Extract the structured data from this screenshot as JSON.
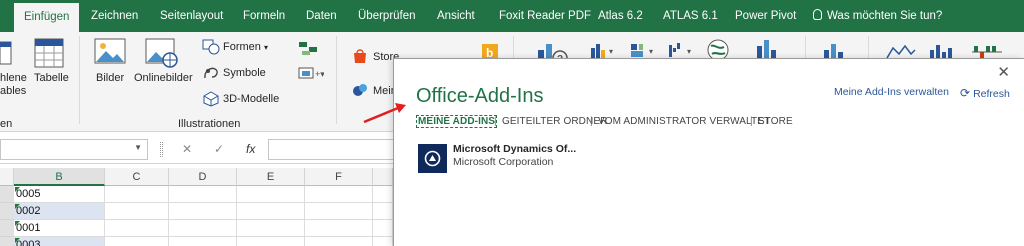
{
  "tabs": [
    {
      "label": "Einfügen",
      "active": true
    },
    {
      "label": "Zeichnen"
    },
    {
      "label": "Seitenlayout"
    },
    {
      "label": "Formeln"
    },
    {
      "label": "Daten"
    },
    {
      "label": "Überprüfen"
    },
    {
      "label": "Ansicht"
    },
    {
      "label": "Foxit Reader PDF"
    },
    {
      "label": "Atlas 6.2"
    },
    {
      "label": "ATLAS 6.1"
    },
    {
      "label": "Power Pivot"
    }
  ],
  "tell_me": "Was möchten Sie tun?",
  "ribbon": {
    "table_cut_line1": "hlene",
    "table_cut_line2": "ables",
    "tabelle": "Tabelle",
    "left_group_cut": "en",
    "bilder": "Bilder",
    "onlinebilder": "Onlinebilder",
    "formen": "Formen",
    "symbole": "Symbole",
    "modelle": "3D-Modelle",
    "illustrationen": "Illustrationen",
    "store": "Store",
    "meine_cut": "Mein"
  },
  "formula_bar": {
    "fx": "fx",
    "cancel": "✕",
    "enter": "✓"
  },
  "grid": {
    "columns": [
      "B",
      "C",
      "D",
      "E",
      "F"
    ],
    "rows": [
      {
        "b": "0005"
      },
      {
        "b": "0002"
      },
      {
        "b": "0001"
      },
      {
        "b": "0003"
      }
    ]
  },
  "dialog": {
    "title": "Office-Add-Ins",
    "close": "✕",
    "manage": "Meine Add-Ins verwalten",
    "refresh": "Refresh",
    "tabs": [
      "MEINE ADD-INS",
      "GEITEILTER ORDNER",
      "VOM ADMINISTRATOR VERWALTET",
      "STORE"
    ],
    "addin": {
      "name": "Microsoft Dynamics Of...",
      "publisher": "Microsoft Corporation"
    }
  },
  "colors": {
    "excel_green": "#217346",
    "link_blue": "#2b579a",
    "arrow_red": "#e02020",
    "addin_icon_bg": "#0f2a5a"
  }
}
